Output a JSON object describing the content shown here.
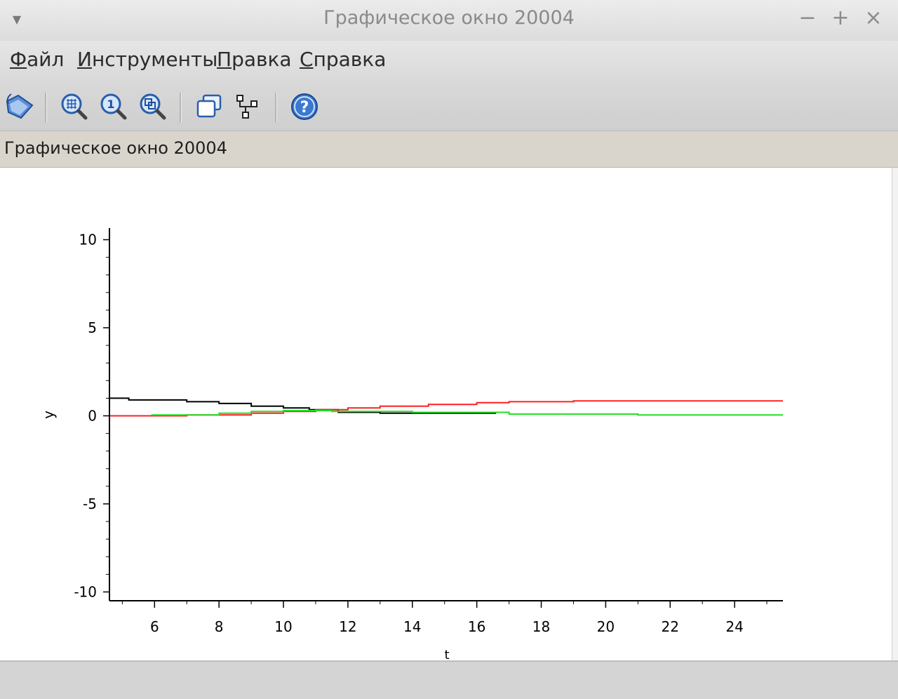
{
  "window": {
    "title": "Графическое окно 20004",
    "minimize_glyph": "−",
    "maximize_glyph": "+",
    "close_glyph": "×"
  },
  "menu": {
    "items": [
      {
        "label": "Файл",
        "mnemonic": "Ф",
        "rest": "айл"
      },
      {
        "label": "Инструменты",
        "mnemonic": "И",
        "rest": "нструменты"
      },
      {
        "label": "Правка",
        "mnemonic": "П",
        "rest": "равка"
      },
      {
        "label": "Справка",
        "mnemonic": "С",
        "rest": "правка"
      }
    ]
  },
  "toolbar": {
    "buttons": [
      {
        "icon": "rotate-icon"
      },
      {
        "icon": "zoom-grid-icon"
      },
      {
        "icon": "zoom-one-icon"
      },
      {
        "icon": "zoom-area-icon"
      },
      {
        "icon": "windows-icon"
      },
      {
        "icon": "datatip-icon"
      },
      {
        "icon": "help-icon"
      }
    ]
  },
  "infobar": {
    "text": "Графическое окно 20004"
  },
  "colors": {
    "series_black": "#000000",
    "series_red": "#ff2020",
    "series_green": "#22e022",
    "axis": "#000000"
  },
  "chart_data": {
    "type": "line",
    "title": "",
    "xlabel": "t",
    "ylabel": "y",
    "xlim": [
      4.6,
      25.5
    ],
    "ylim": [
      -10.5,
      10.5
    ],
    "x_ticks": [
      6,
      8,
      10,
      12,
      14,
      16,
      18,
      20,
      22,
      24
    ],
    "y_ticks": [
      10,
      5,
      0,
      -5,
      -10
    ],
    "grid": false,
    "step": true,
    "series": [
      {
        "color": "black",
        "points": [
          [
            4.6,
            1.0
          ],
          [
            5.2,
            1.0
          ],
          [
            5.2,
            0.9
          ],
          [
            7.0,
            0.9
          ],
          [
            7.0,
            0.8
          ],
          [
            8.0,
            0.8
          ],
          [
            8.0,
            0.7
          ],
          [
            9.0,
            0.7
          ],
          [
            9.0,
            0.55
          ],
          [
            10.0,
            0.55
          ],
          [
            10.0,
            0.45
          ],
          [
            10.8,
            0.45
          ],
          [
            10.8,
            0.35
          ],
          [
            11.7,
            0.35
          ],
          [
            11.7,
            0.2
          ],
          [
            13.0,
            0.2
          ],
          [
            13.0,
            0.15
          ],
          [
            16.6,
            0.15
          ]
        ]
      },
      {
        "color": "red",
        "points": [
          [
            4.6,
            0.0
          ],
          [
            7.0,
            0.0
          ],
          [
            7.0,
            0.05
          ],
          [
            9.0,
            0.05
          ],
          [
            9.0,
            0.15
          ],
          [
            10.0,
            0.15
          ],
          [
            10.0,
            0.25
          ],
          [
            11.0,
            0.25
          ],
          [
            11.0,
            0.35
          ],
          [
            12.0,
            0.35
          ],
          [
            12.0,
            0.45
          ],
          [
            13.0,
            0.45
          ],
          [
            13.0,
            0.55
          ],
          [
            14.5,
            0.55
          ],
          [
            14.5,
            0.65
          ],
          [
            16.0,
            0.65
          ],
          [
            16.0,
            0.75
          ],
          [
            17.0,
            0.75
          ],
          [
            17.0,
            0.8
          ],
          [
            19.0,
            0.8
          ],
          [
            19.0,
            0.85
          ],
          [
            25.5,
            0.85
          ]
        ]
      },
      {
        "color": "green",
        "points": [
          [
            5.9,
            0.05
          ],
          [
            8.0,
            0.05
          ],
          [
            8.0,
            0.15
          ],
          [
            9.0,
            0.15
          ],
          [
            9.0,
            0.25
          ],
          [
            10.0,
            0.25
          ],
          [
            10.0,
            0.3
          ],
          [
            11.5,
            0.3
          ],
          [
            11.5,
            0.25
          ],
          [
            14.0,
            0.25
          ],
          [
            14.0,
            0.2
          ],
          [
            17.0,
            0.2
          ],
          [
            17.0,
            0.1
          ],
          [
            21.0,
            0.1
          ],
          [
            21.0,
            0.05
          ],
          [
            25.5,
            0.05
          ]
        ]
      }
    ]
  }
}
